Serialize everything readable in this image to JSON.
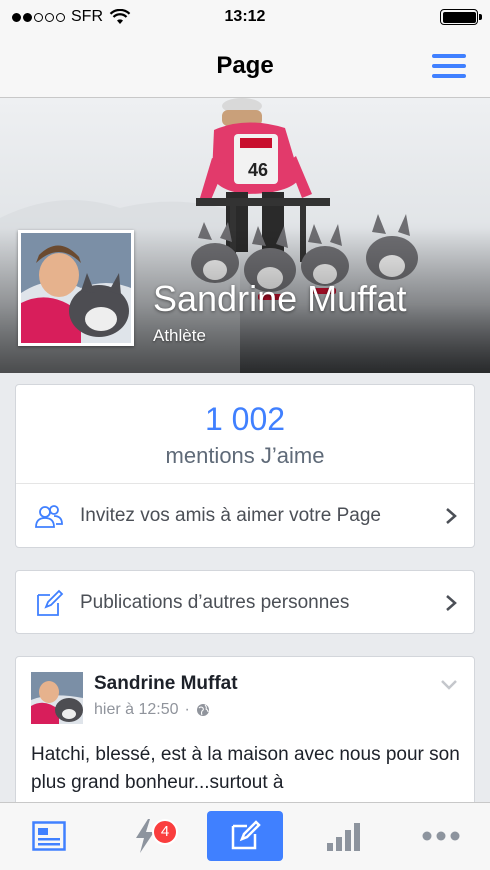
{
  "status_bar": {
    "carrier": "SFR",
    "time": "13:12",
    "signal_bars": 2,
    "signal_max": 5,
    "battery_level": 1.0
  },
  "nav": {
    "title": "Page",
    "menu_icon": "hamburger-menu-icon"
  },
  "header": {
    "name": "Sandrine Muffat",
    "category": "Athlète",
    "bib_number": "46"
  },
  "likes": {
    "count": "1 002",
    "label": "mentions J’aime"
  },
  "actions": {
    "invite_label": "Invitez vos amis à aimer votre Page",
    "invite_icon": "friends-icon",
    "posts_label": "Publications d’autres personnes",
    "posts_icon": "compose-icon"
  },
  "post": {
    "author": "Sandrine Muffat",
    "time": "hier à 12:50",
    "separator": "·",
    "audience_icon": "globe-icon",
    "text": "Hatchi, blessé, est à la maison avec nous pour son plus grand bonheur...surtout à"
  },
  "tabs": {
    "notifications_badge": "4",
    "items": [
      "feed-icon",
      "notifications-bolt-icon",
      "compose-icon",
      "insights-bars-icon",
      "more-dots-icon"
    ]
  },
  "colors": {
    "accent": "#4080ff",
    "badge": "#fa3e3e"
  }
}
